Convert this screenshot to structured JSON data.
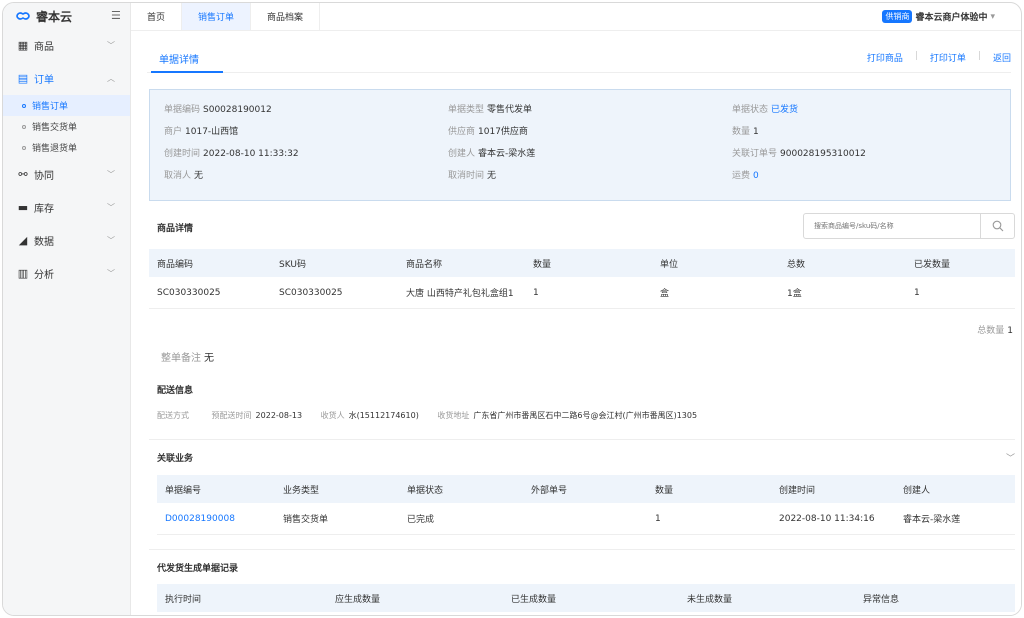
{
  "brand": {
    "name": "睿本云",
    "collapse_icon": "menu-fold-icon"
  },
  "sidebar": {
    "groups": [
      {
        "label": "商品",
        "icon": "grid-icon"
      },
      {
        "label": "订单",
        "icon": "document-icon"
      },
      {
        "label": "协同",
        "icon": "collaborate-icon"
      },
      {
        "label": "库存",
        "icon": "inventory-icon"
      },
      {
        "label": "数据",
        "icon": "data-chart-icon"
      },
      {
        "label": "分析",
        "icon": "bar-chart-icon"
      }
    ],
    "order_items": [
      {
        "label": "销售订单"
      },
      {
        "label": "销售交货单"
      },
      {
        "label": "销售退货单"
      }
    ]
  },
  "topbar": {
    "tabs": [
      "首页",
      "销售订单",
      "商品档案"
    ],
    "badge": "供销商",
    "merchant": "睿本云商户体验中"
  },
  "header": {
    "tab": "单据详情",
    "actions": [
      "打印商品",
      "打印订单",
      "返回"
    ]
  },
  "info": {
    "code_label": "单据编码",
    "code": "S00028190012",
    "type_label": "单据类型",
    "type": "零售代发单",
    "status_label": "单据状态",
    "status": "已发货",
    "merchant_label": "商户",
    "merchant": "1017-山西馆",
    "supplier_label": "供应商",
    "supplier": "1017供应商",
    "qty_label": "数量",
    "qty": "1",
    "created_label": "创建时间",
    "created": "2022-08-10 11:33:32",
    "creator_label": "创建人",
    "creator": "睿本云-梁水莲",
    "linked_label": "关联订单号",
    "linked": "900028195310012",
    "canceler_label": "取消人",
    "canceler": "无",
    "cancel_time_label": "取消时间",
    "cancel_time": "无",
    "freight_label": "运费",
    "freight": "0"
  },
  "goods": {
    "title": "商品详情",
    "search_placeholder": "搜索商品编号/sku码/名称",
    "columns": [
      "商品编码",
      "SKU码",
      "商品名称",
      "数量",
      "单位",
      "总数",
      "已发数量"
    ],
    "rows": [
      [
        "SC030330025",
        "SC030330025",
        "大唐 山西特产礼包礼盒组1",
        "1",
        "盒",
        "1盒",
        "1"
      ]
    ],
    "total_label": "总数量",
    "total": "1"
  },
  "remark": {
    "label": "整单备注",
    "value": "无"
  },
  "delivery": {
    "title": "配送信息",
    "method_label": "配送方式",
    "date_label": "预配送时间",
    "date": "2022-08-13",
    "receiver_label": "收货人",
    "receiver": "水(15112174610)",
    "address_label": "收货地址",
    "address": "广东省广州市番禺区石中二路6号@会江村(广州市番禺区)1305"
  },
  "related": {
    "title": "关联业务",
    "columns": [
      "单据编号",
      "业务类型",
      "单据状态",
      "外部单号",
      "数量",
      "创建时间",
      "创建人"
    ],
    "rows": [
      [
        "D00028190008",
        "销售交货单",
        "已完成",
        "",
        "1",
        "2022-08-10 11:34:16",
        "睿本云-梁水莲"
      ]
    ]
  },
  "records": {
    "title": "代发货生成单据记录",
    "columns": [
      "执行时间",
      "应生成数量",
      "已生成数量",
      "未生成数量",
      "异常信息"
    ]
  }
}
